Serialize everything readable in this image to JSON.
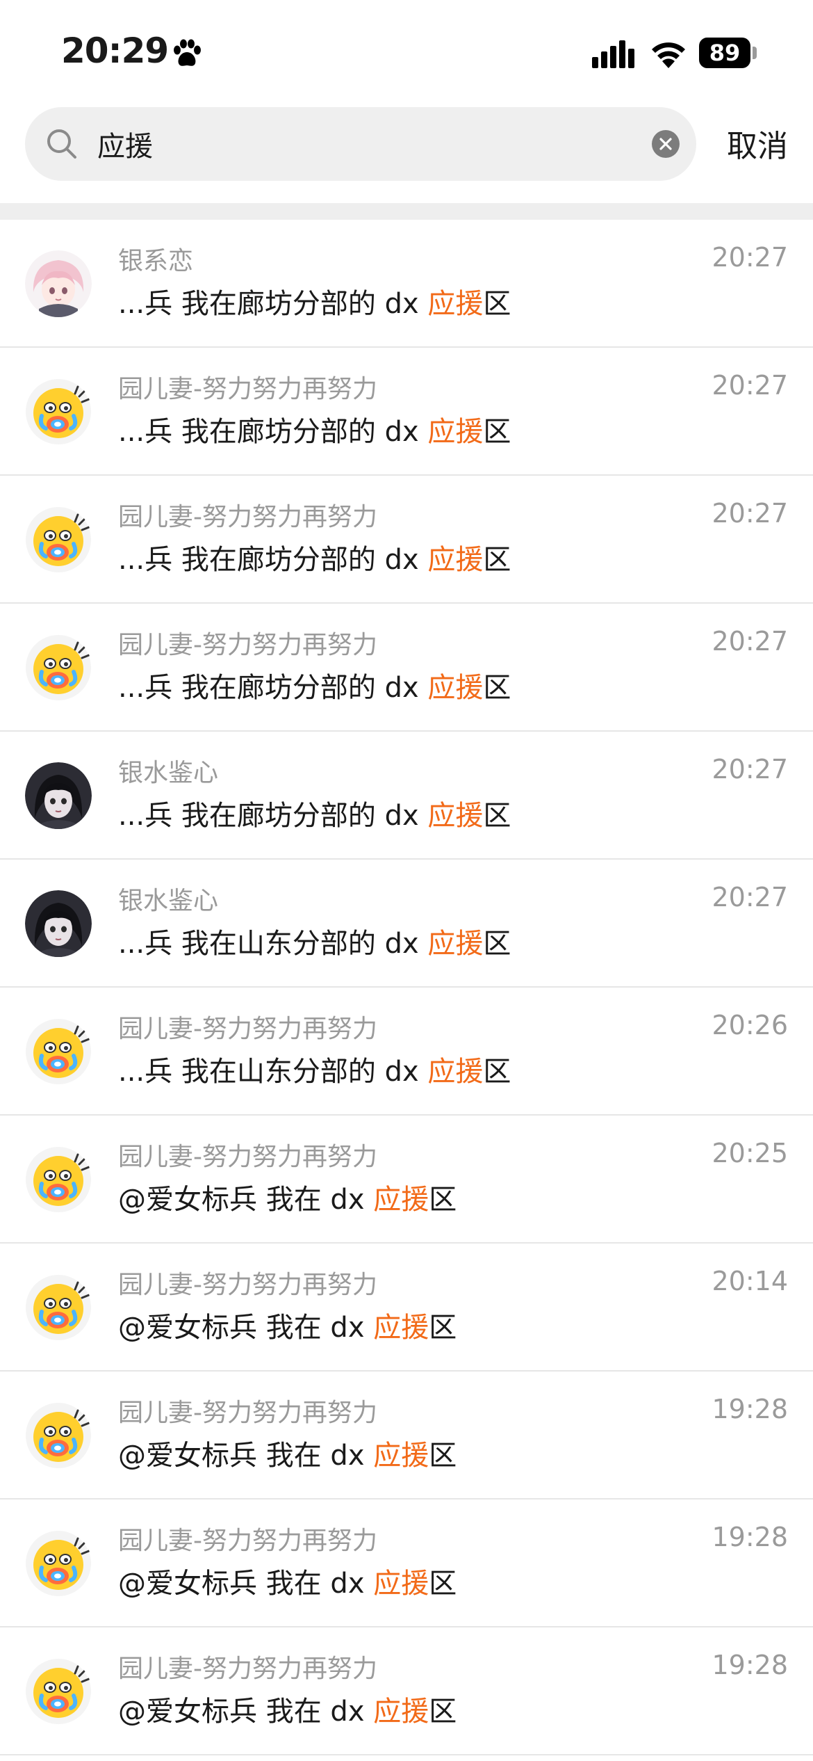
{
  "status_bar": {
    "time": "20:29",
    "battery": "89"
  },
  "search": {
    "query": "应援",
    "cancel_label": "取消"
  },
  "colors": {
    "highlight": "#f26a18",
    "secondary_text": "#9a9a9a"
  },
  "results": [
    {
      "sender": "银系恋",
      "prefix": "...兵 我在廊坊分部的 dx ",
      "keyword": "应援",
      "suffix": "区",
      "time": "20:27",
      "avatar": "anime-girl-pink"
    },
    {
      "sender": "园儿妻-努力努力再努力",
      "prefix": "...兵 我在廊坊分部的 dx ",
      "keyword": "应援",
      "suffix": "区",
      "time": "20:27",
      "avatar": "crying-emoji"
    },
    {
      "sender": "园儿妻-努力努力再努力",
      "prefix": "...兵 我在廊坊分部的 dx ",
      "keyword": "应援",
      "suffix": "区",
      "time": "20:27",
      "avatar": "crying-emoji"
    },
    {
      "sender": "园儿妻-努力努力再努力",
      "prefix": "...兵 我在廊坊分部的 dx ",
      "keyword": "应援",
      "suffix": "区",
      "time": "20:27",
      "avatar": "crying-emoji"
    },
    {
      "sender": "银水鉴心",
      "prefix": "...兵 我在廊坊分部的 dx ",
      "keyword": "应援",
      "suffix": "区",
      "time": "20:27",
      "avatar": "dark-hair-girl"
    },
    {
      "sender": "银水鉴心",
      "prefix": "...兵 我在山东分部的 dx ",
      "keyword": "应援",
      "suffix": "区",
      "time": "20:27",
      "avatar": "dark-hair-girl"
    },
    {
      "sender": "园儿妻-努力努力再努力",
      "prefix": "...兵 我在山东分部的 dx ",
      "keyword": "应援",
      "suffix": "区",
      "time": "20:26",
      "avatar": "crying-emoji"
    },
    {
      "sender": "园儿妻-努力努力再努力",
      "prefix": "@爱女标兵 我在 dx ",
      "keyword": "应援",
      "suffix": "区",
      "time": "20:25",
      "avatar": "crying-emoji"
    },
    {
      "sender": "园儿妻-努力努力再努力",
      "prefix": "@爱女标兵 我在 dx ",
      "keyword": "应援",
      "suffix": "区",
      "time": "20:14",
      "avatar": "crying-emoji"
    },
    {
      "sender": "园儿妻-努力努力再努力",
      "prefix": "@爱女标兵 我在 dx ",
      "keyword": "应援",
      "suffix": "区",
      "time": "19:28",
      "avatar": "crying-emoji"
    },
    {
      "sender": "园儿妻-努力努力再努力",
      "prefix": "@爱女标兵 我在 dx ",
      "keyword": "应援",
      "suffix": "区",
      "time": "19:28",
      "avatar": "crying-emoji"
    },
    {
      "sender": "园儿妻-努力努力再努力",
      "prefix": "@爱女标兵 我在 dx ",
      "keyword": "应援",
      "suffix": "区",
      "time": "19:28",
      "avatar": "crying-emoji"
    }
  ]
}
